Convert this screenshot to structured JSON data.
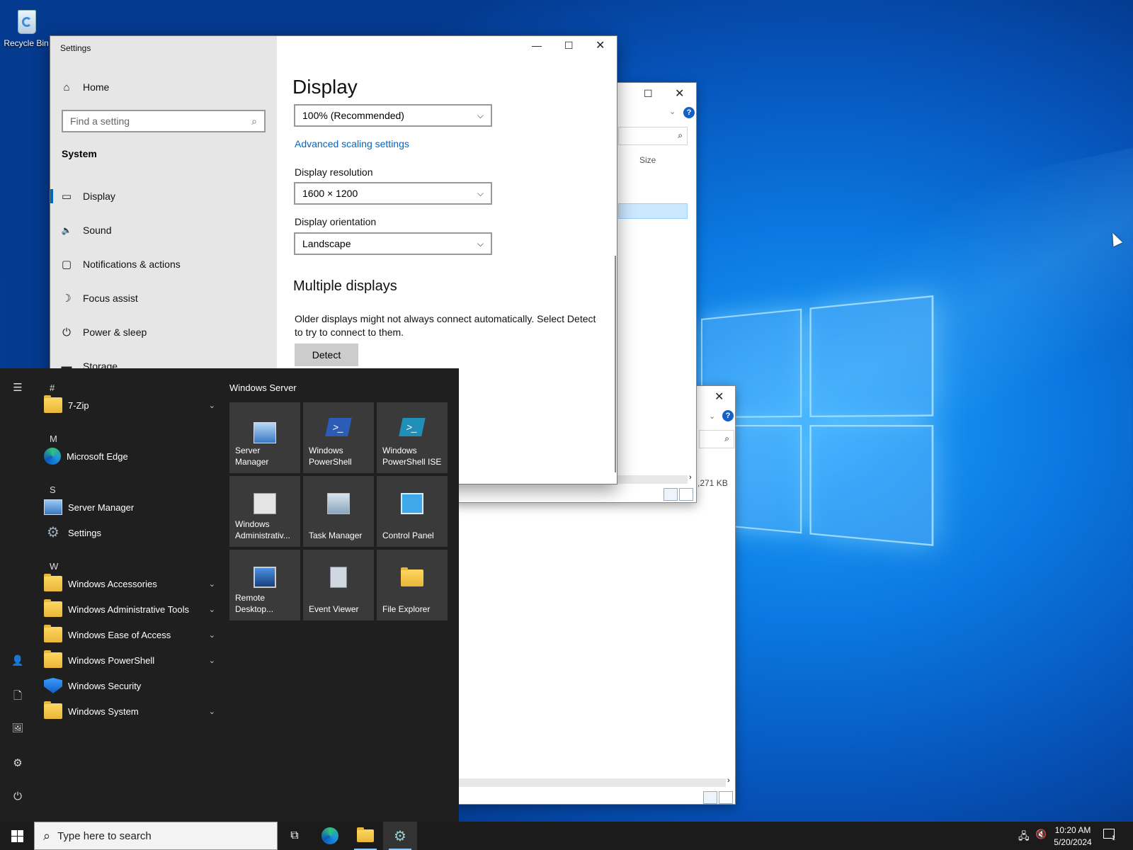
{
  "desktop": {
    "recycle_bin_label": "Recycle Bin"
  },
  "explorer_back": {
    "column_size": "Size",
    "help_glyph": "?",
    "max_glyph": "☐",
    "close_glyph": "✕"
  },
  "explorer_back2": {
    "size_value": ",271 KB",
    "help_glyph": "?",
    "close_glyph": "✕"
  },
  "settings": {
    "window_title": "Settings",
    "home_label": "Home",
    "search_placeholder": "Find a setting",
    "section_label": "System",
    "nav": [
      {
        "label": "Display",
        "icon": "monitor-icon",
        "glyph": "▭"
      },
      {
        "label": "Sound",
        "icon": "speaker-icon",
        "glyph": "🔈"
      },
      {
        "label": "Notifications & actions",
        "icon": "notification-icon",
        "glyph": "▢"
      },
      {
        "label": "Focus assist",
        "icon": "moon-icon",
        "glyph": "☽"
      },
      {
        "label": "Power & sleep",
        "icon": "power-icon",
        "glyph": "⏻"
      },
      {
        "label": "Storage",
        "icon": "storage-icon",
        "glyph": "▬"
      }
    ],
    "page_title": "Display",
    "scale_value": "100% (Recommended)",
    "advanced_scaling_link": "Advanced scaling settings",
    "resolution_label": "Display resolution",
    "resolution_value": "1600 × 1200",
    "orientation_label": "Display orientation",
    "orientation_value": "Landscape",
    "multiple_displays_heading": "Multiple displays",
    "multiple_displays_text": "Older displays might not always connect automatically. Select Detect to try to connect to them.",
    "detect_button": "Detect",
    "minimize_glyph": "—",
    "maximize_glyph": "☐",
    "close_glyph": "✕"
  },
  "start_menu": {
    "letters": {
      "hash": "#",
      "m": "M",
      "s": "S",
      "w": "W"
    },
    "apps": [
      {
        "label": "7-Zip",
        "icon": "folder-icon",
        "expandable": true
      },
      {
        "label": "Microsoft Edge",
        "icon": "edge-icon",
        "expandable": false
      },
      {
        "label": "Server Manager",
        "icon": "server-manager-icon",
        "expandable": false
      },
      {
        "label": "Settings",
        "icon": "gear-icon",
        "expandable": false
      },
      {
        "label": "Windows Accessories",
        "icon": "folder-icon",
        "expandable": true
      },
      {
        "label": "Windows Administrative Tools",
        "icon": "folder-icon",
        "expandable": true
      },
      {
        "label": "Windows Ease of Access",
        "icon": "folder-icon",
        "expandable": true
      },
      {
        "label": "Windows PowerShell",
        "icon": "folder-icon",
        "expandable": true
      },
      {
        "label": "Windows Security",
        "icon": "shield-icon",
        "expandable": false
      },
      {
        "label": "Windows System",
        "icon": "folder-icon",
        "expandable": true
      }
    ],
    "group_title": "Windows Server",
    "tiles": [
      {
        "label": "Server Manager",
        "icon": "server-manager-icon"
      },
      {
        "label": "Windows PowerShell",
        "icon": "powershell-icon"
      },
      {
        "label": "Windows PowerShell ISE",
        "icon": "powershell-ise-icon"
      },
      {
        "label": "Windows Administrativ...",
        "icon": "admin-tools-icon"
      },
      {
        "label": "Task Manager",
        "icon": "task-manager-icon"
      },
      {
        "label": "Control Panel",
        "icon": "control-panel-icon"
      },
      {
        "label": "Remote Desktop...",
        "icon": "remote-desktop-icon"
      },
      {
        "label": "Event Viewer",
        "icon": "event-viewer-icon"
      },
      {
        "label": "File Explorer",
        "icon": "file-explorer-icon"
      }
    ],
    "rail": {
      "hamburger": "☰",
      "user": "👤",
      "documents": "🗋",
      "pictures": "🖼",
      "settings": "⚙",
      "power": "⏻"
    }
  },
  "taskbar": {
    "search_placeholder": "Type here to search",
    "time": "10:20 AM",
    "date": "5/20/2024",
    "notification_count": "1",
    "task_view_glyph": "⧉"
  },
  "colors": {
    "accent": "#0067c0",
    "tile_bg": "#3a3a3a",
    "start_bg": "#1f1f1f"
  }
}
